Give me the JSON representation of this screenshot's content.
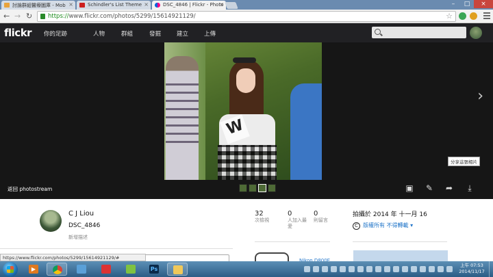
{
  "browser": {
    "tabs": [
      {
        "title": "討論群組醫療圖庫 - Mob",
        "favicon_color": "#e8a33c",
        "active": false
      },
      {
        "title": "Schindler's List Theme",
        "favicon_color": "#cc1f1f",
        "active": false
      },
      {
        "title": "DSC_4846 | Flickr - Photo",
        "favicon_color": "#ff0084",
        "active": true
      }
    ],
    "url_scheme": "https://",
    "url_rest": "www.flickr.com/photos/5299/15614921129/",
    "status_url": "https://www.flickr.com/photos/5299/15614921129/#"
  },
  "flickr": {
    "logo": "flickr",
    "nav": [
      "你的足跡",
      "人物",
      "群組",
      "發掘",
      "建立",
      "上傳"
    ],
    "back_label": "返回 photostream",
    "thumbnail_count": 4,
    "action_tooltip": "分享這張相片",
    "owner_name": "C J Liou",
    "photo_title": "DSC_4846",
    "add_description": "新增描述",
    "stats": [
      {
        "num": "32",
        "label": "次檢視"
      },
      {
        "num": "0",
        "label": "人加入最愛"
      },
      {
        "num": "0",
        "label": "則留言"
      }
    ],
    "taken_text": "拍攝於 2014 年 十一月 16",
    "license_text": "版權所有 不得轉載",
    "camera_text": "Nikon D800E"
  },
  "taskbar": {
    "time": "上午 07:53",
    "date": "2014/11/17"
  }
}
